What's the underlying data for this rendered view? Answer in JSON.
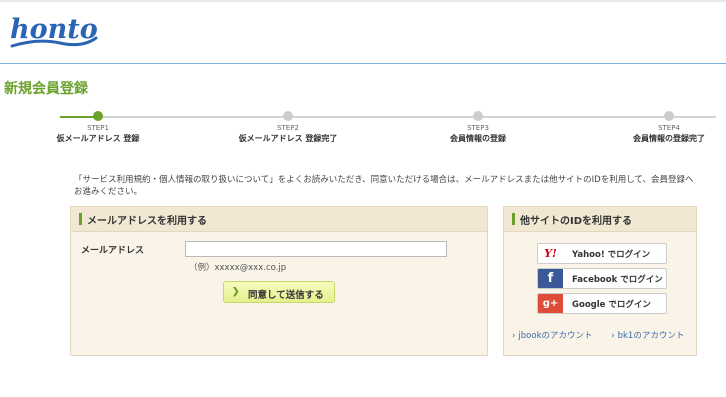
{
  "header": {
    "logo_text": "honto"
  },
  "page": {
    "title": "新規会員登録"
  },
  "steps": [
    {
      "no": "STEP1",
      "label": "仮メールアドレス 登録",
      "active": true
    },
    {
      "no": "STEP2",
      "label": "仮メールアドレス 登録完了",
      "active": false
    },
    {
      "no": "STEP3",
      "label": "会員情報の登録",
      "active": false
    },
    {
      "no": "STEP4",
      "label": "会員情報の登録完了",
      "active": false
    }
  ],
  "notice": "「サービス利用規約・個人情報の取り扱いについて」をよくお読みいただき、同意いただける場合は、メールアドレスまたは他サイトのIDを利用して、会員登録へお進みください。",
  "email_panel": {
    "title": "メールアドレスを利用する",
    "field_label": "メールアドレス",
    "input_value": "",
    "example": "（例）xxxxx@xxx.co.jp",
    "submit_label": "同意して送信する"
  },
  "social_panel": {
    "title": "他サイトのIDを利用する",
    "yahoo_icon": "Y!",
    "yahoo_label": "Yahoo! でログイン",
    "facebook_icon": "f",
    "facebook_label": "Facebook でログイン",
    "google_icon": "g+",
    "google_label": "Google でログイン",
    "link_jbook": "jbookのアカウント",
    "link_bk1": "bk1のアカウント"
  },
  "colors": {
    "accent": "#6aa12b",
    "logo": "#2a65b5",
    "panel_bg": "#f9f3e8"
  }
}
